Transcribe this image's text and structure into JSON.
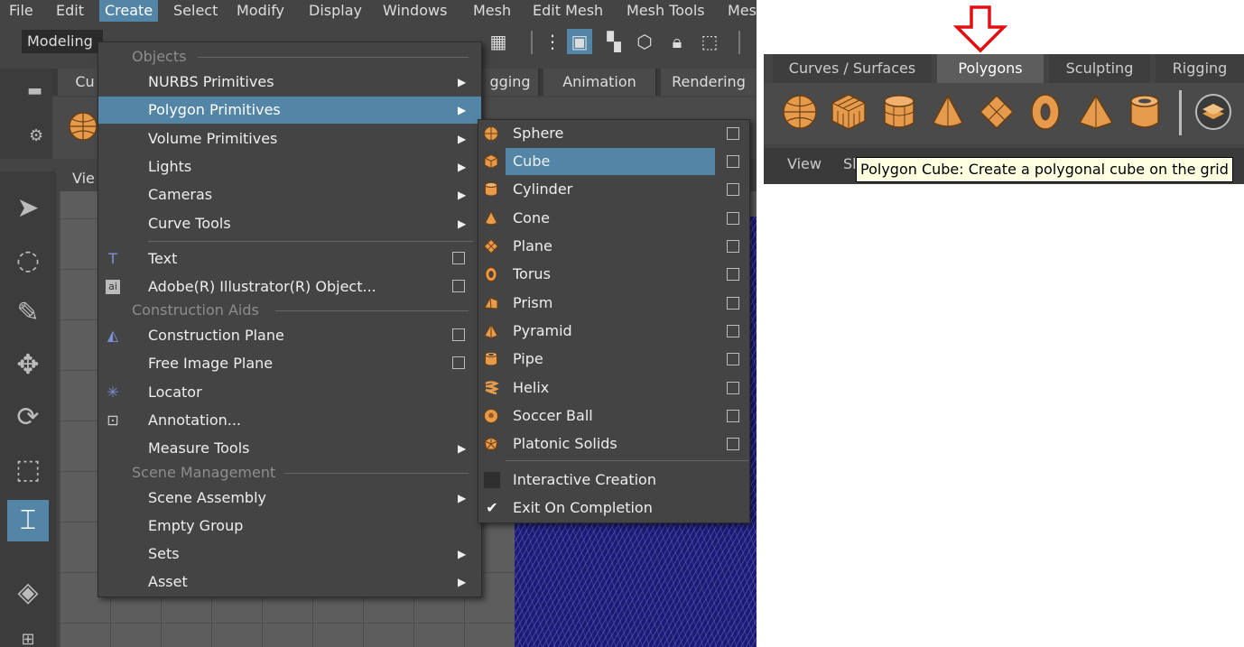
{
  "menubar": {
    "items": [
      "File",
      "Edit",
      "Create",
      "Select",
      "Modify",
      "Display",
      "Windows",
      "Mesh",
      "Edit Mesh",
      "Mesh Tools",
      "Mes"
    ],
    "active": "Create"
  },
  "toolbar": {
    "workspace_select": "Modeling"
  },
  "shelf_tabs_left": [
    "Cu",
    "gging",
    "Animation",
    "Rendering"
  ],
  "viewport": {
    "menu_partial": "Vie"
  },
  "create_menu": {
    "sections": {
      "objects": "Objects",
      "construction_aids": "Construction Aids",
      "scene_management": "Scene Management"
    },
    "items": {
      "nurbs": "NURBS Primitives",
      "polygon": "Polygon Primitives",
      "volume": "Volume Primitives",
      "lights": "Lights",
      "cameras": "Cameras",
      "curve_tools": "Curve Tools",
      "text": "Text",
      "illustrator": "Adobe(R) Illustrator(R) Object...",
      "construction_plane": "Construction Plane",
      "free_image_plane": "Free Image Plane",
      "locator": "Locator",
      "annotation": "Annotation...",
      "measure_tools": "Measure Tools",
      "scene_assembly": "Scene Assembly",
      "empty_group": "Empty Group",
      "sets": "Sets",
      "asset": "Asset"
    }
  },
  "polygon_submenu": {
    "items": [
      "Sphere",
      "Cube",
      "Cylinder",
      "Cone",
      "Plane",
      "Torus",
      "Prism",
      "Pyramid",
      "Pipe",
      "Helix",
      "Soccer Ball",
      "Platonic Solids"
    ],
    "highlighted": "Cube",
    "interactive_creation": "Interactive Creation",
    "exit_on_completion": "Exit On Completion"
  },
  "right_panel": {
    "tabs": [
      "Curves / Surfaces",
      "Polygons",
      "Sculpting",
      "Rigging"
    ],
    "active_tab": "Polygons",
    "bar_labels": {
      "view": "View",
      "partial": "Sl"
    },
    "tooltip": "Polygon Cube: Create a polygonal cube on the grid"
  },
  "colors": {
    "highlight": "#5285a6",
    "menu_bg": "#444444",
    "icon_orange": "#e69a4b",
    "arrow_red": "#e01010",
    "tooltip_bg": "#ffffe1"
  }
}
